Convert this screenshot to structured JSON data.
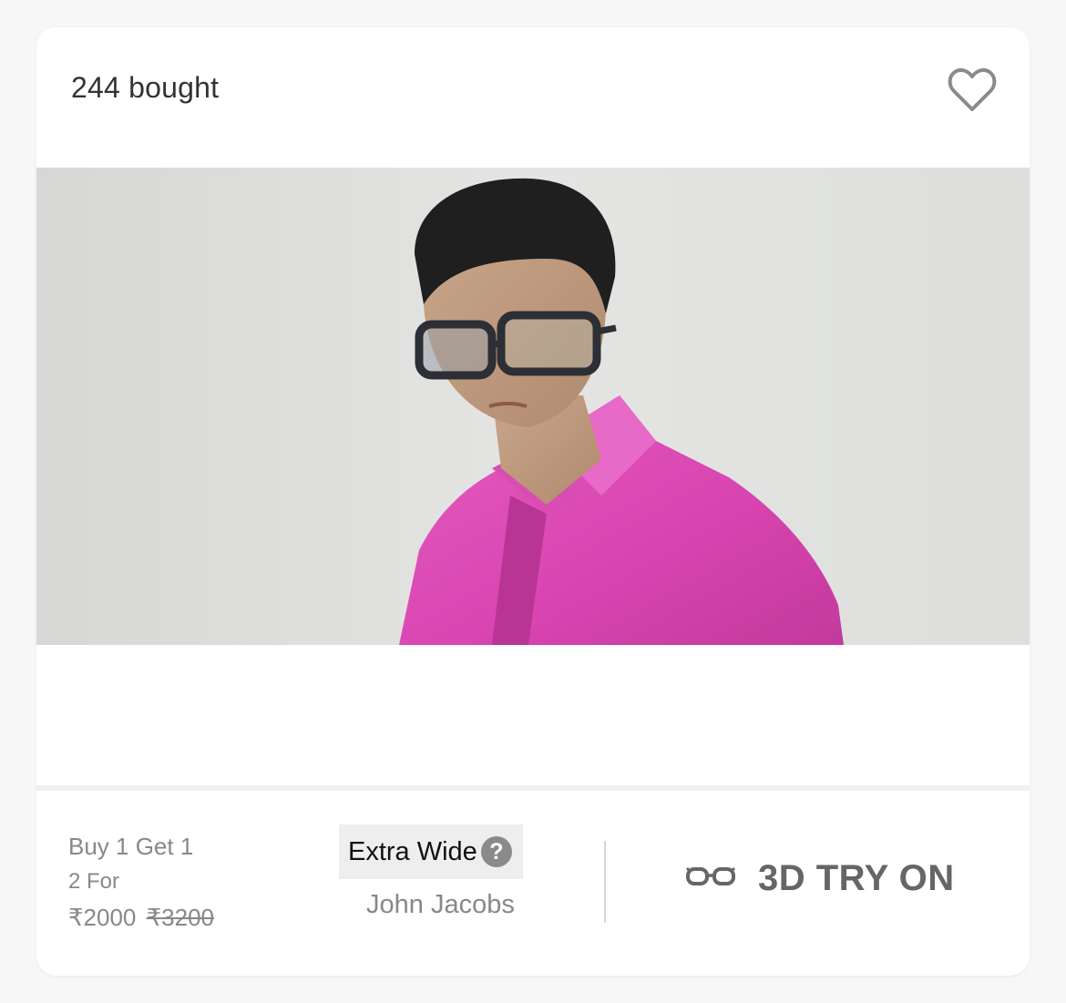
{
  "card": {
    "bought_text": "244 bought",
    "wishlist_icon": "heart-outline-icon"
  },
  "image": {
    "alt": "Model wearing eyeglasses",
    "shirt_color": "#e04fb9",
    "background_color": "#e2e3e1"
  },
  "offer": {
    "line1": "Buy 1 Get 1",
    "line2": "2 For",
    "price": "₹2000",
    "original_price": "₹3200"
  },
  "size": {
    "label": "Extra Wide",
    "help_glyph": "?"
  },
  "brand": "John Jacobs",
  "try_on": {
    "label": "3D TRY ON",
    "icon": "glasses-icon"
  },
  "colors": {
    "text_primary": "#333333",
    "text_secondary": "#888888",
    "help_icon_bg": "#8a8a8a"
  }
}
